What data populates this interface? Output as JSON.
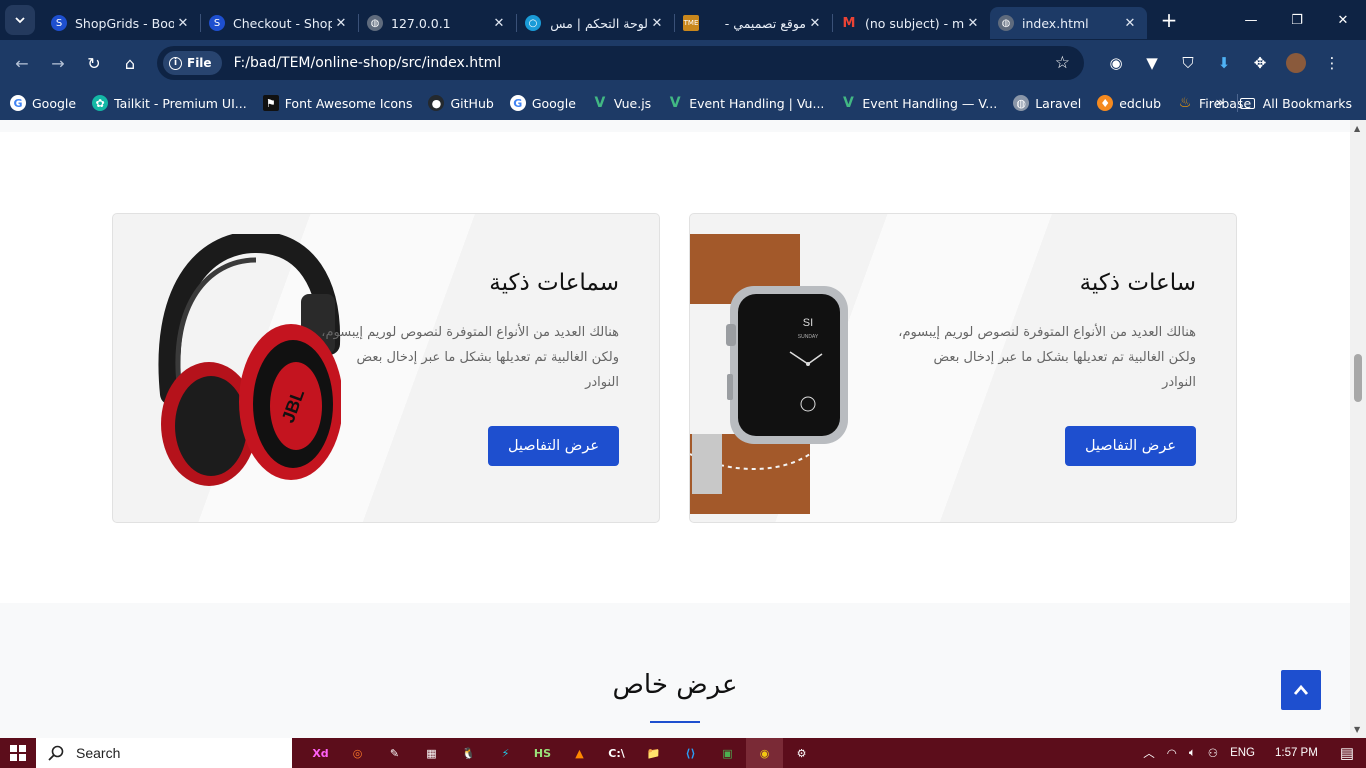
{
  "browser": {
    "tabs": [
      {
        "title": "ShopGrids - Boo",
        "favicon": "shopgrids-icon",
        "active": false
      },
      {
        "title": "Checkout - Shop",
        "favicon": "shopgrids-icon",
        "active": false
      },
      {
        "title": "127.0.0.1",
        "favicon": "globe-icon",
        "active": false
      },
      {
        "title": "لوحة التحكم | مس",
        "favicon": "circle-icon",
        "active": false
      },
      {
        "title": "موقع تصميمي -",
        "favicon": "tme-icon",
        "active": false
      },
      {
        "title": "(no subject) - m",
        "favicon": "gmail-icon",
        "active": false
      },
      {
        "title": "index.html",
        "favicon": "globe-icon",
        "active": true
      }
    ],
    "file_chip": "File",
    "url": "F:/bad/TEM/online-shop/src/index.html",
    "bookmarks": [
      {
        "label": "Google",
        "icon": "google-icon"
      },
      {
        "label": "Tailkit - Premium UI...",
        "icon": "tailkit-icon"
      },
      {
        "label": "Font Awesome Icons",
        "icon": "flag-icon"
      },
      {
        "label": "GitHub",
        "icon": "github-icon"
      },
      {
        "label": "Google",
        "icon": "google-icon"
      },
      {
        "label": "Vue.js",
        "icon": "vue-icon"
      },
      {
        "label": "Event Handling | Vu...",
        "icon": "vue-icon"
      },
      {
        "label": "Event Handling — V...",
        "icon": "vue-icon"
      },
      {
        "label": "Laravel",
        "icon": "globe-icon"
      },
      {
        "label": "edclub",
        "icon": "edclub-icon"
      },
      {
        "label": "Firebase",
        "icon": "firebase-icon"
      }
    ],
    "bookmarks_more": "»",
    "all_bookmarks": "All Bookmarks"
  },
  "page": {
    "cards": [
      {
        "title": "سماعات ذكية",
        "description": "هنالك العديد من الأنواع المتوفرة لنصوص لوريم إيبسوم، ولكن الغالبية تم تعديلها بشكل ما عبر إدخال بعض النوادر",
        "button": "عرض التفاصيل",
        "image": "headphones-image",
        "logo": "JBL"
      },
      {
        "title": "ساعات ذكية",
        "description": "هنالك العديد من الأنواع المتوفرة لنصوص لوريم إيبسوم، ولكن الغالبية تم تعديلها بشكل ما عبر إدخال بعض النوادر",
        "button": "عرض التفاصيل",
        "image": "smartwatch-image",
        "watch_face": {
          "date": "SI",
          "day": "SUNDAY"
        }
      }
    ],
    "section_title": "عرض خاص"
  },
  "taskbar": {
    "search_label": "Search",
    "apps": [
      "Xd",
      "◎",
      "✎",
      "▦",
      "🐧",
      "⚡",
      "HS",
      "▲",
      "C:\\",
      "📁",
      "⟨⟩",
      "▣",
      "◉",
      "⚙"
    ],
    "language": "ENG",
    "time": "1:57 PM"
  },
  "colors": {
    "accent": "#1e4fcf",
    "browser_frame": "#0e2344",
    "browser_toolbar": "#1d3a66",
    "taskbar": "#5c0d1b"
  }
}
